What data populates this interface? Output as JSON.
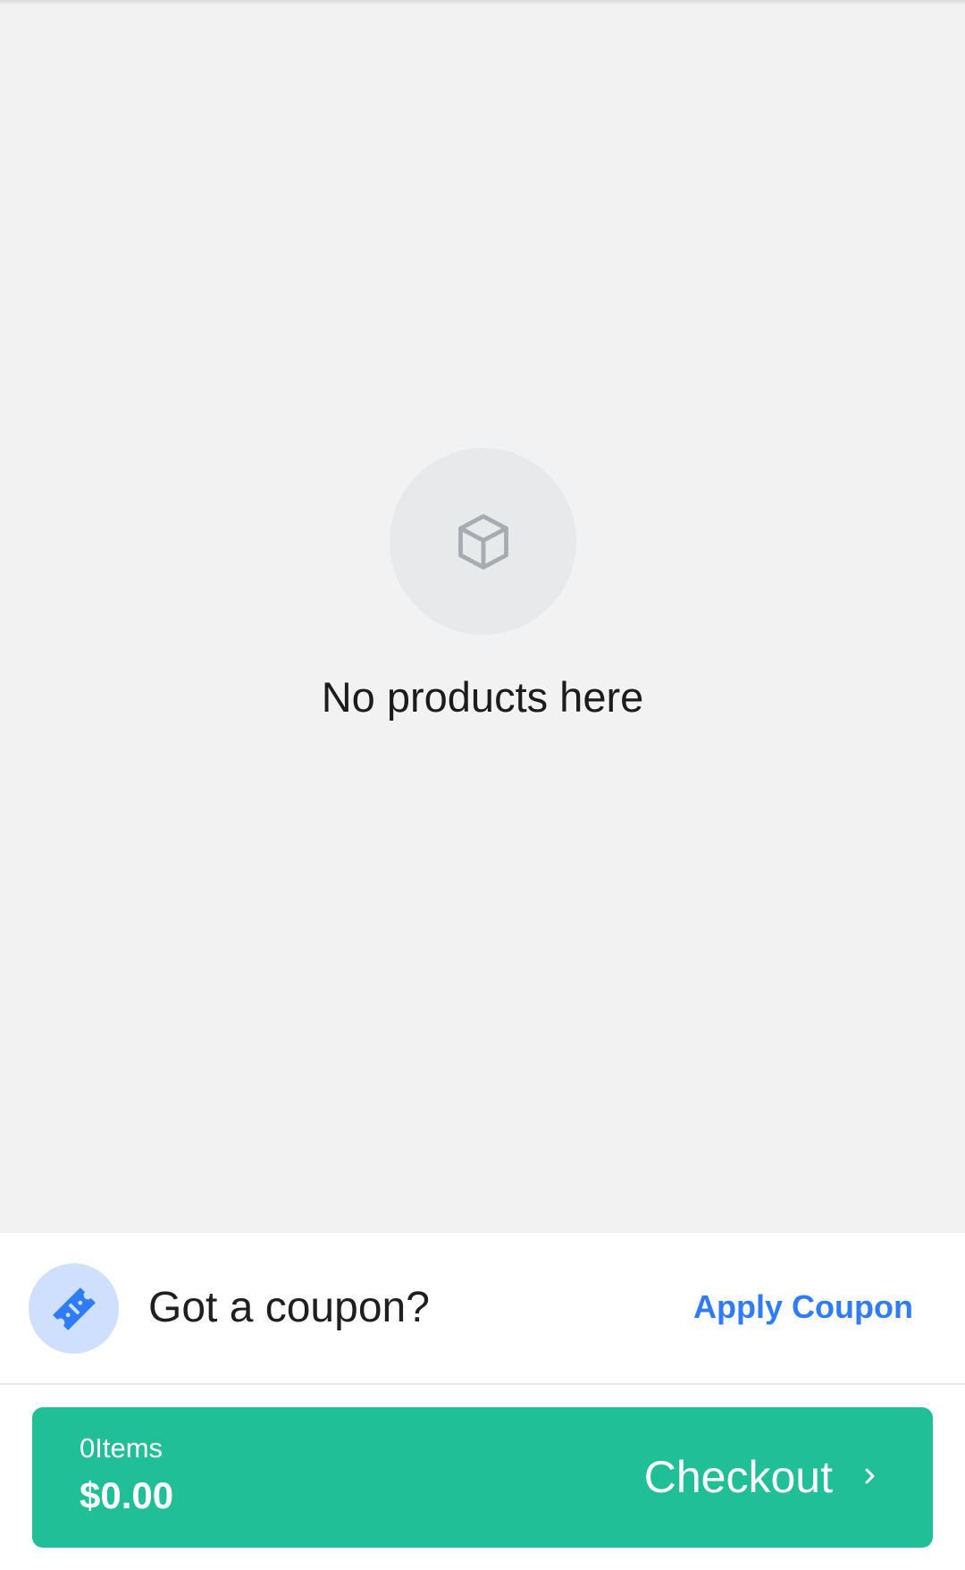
{
  "empty_state": {
    "icon": "box-icon",
    "message": "No products here"
  },
  "coupon": {
    "icon": "ticket-icon",
    "title": "Got a coupon?",
    "action_label": "Apply Coupon"
  },
  "checkout": {
    "item_count": "0Items",
    "total": "$0.00",
    "label": "Checkout",
    "icon": "chevron-right-icon"
  },
  "colors": {
    "background": "#f2f2f2",
    "accent_green": "#20bf97",
    "link_blue": "#2f7cf6",
    "coupon_icon_bg": "#cfe0ff",
    "empty_icon_bg": "#e8e9eb"
  }
}
